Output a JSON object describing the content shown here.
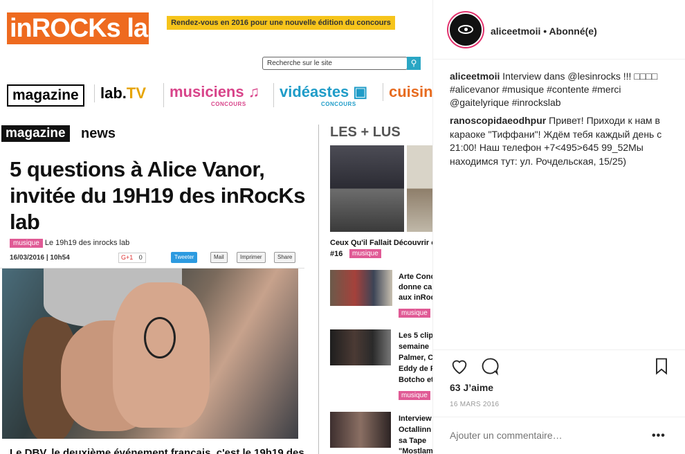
{
  "photo": {
    "logo": "inROCKs lab",
    "banner": "Rendez-vous en 2016 pour une nouvelle édition du concours",
    "search_placeholder": "Recherche sur le site",
    "nav": {
      "magazine": "magazine",
      "lab_prefix": "lab.",
      "lab_suffix": "TV",
      "musiciens": "musiciens",
      "musiciens_sub": "CONCOURS",
      "videastes": "vidéastes",
      "videastes_sub": "CONCOURS",
      "cuisine": "cuisin"
    },
    "section": "magazine",
    "section_sub": "news",
    "headline": "5 questions à Alice Vanor, invitée du 19H19 des inRocKs lab",
    "tag": "musique",
    "tagline": "Le 19h19 des inrocks lab",
    "date": "16/03/2016 | 10h54",
    "gplus": "G+1",
    "gplus_count": "0",
    "share_buttons": [
      "Tweeter",
      "Mail",
      "Imprimer",
      "Share"
    ],
    "bottom_text": "Le DBV, le deuxième événement francais, c'est le 19h19 des",
    "sidebar": {
      "title": "LES + LUS",
      "item1_caption": "Ceux Qu'il Fallait Découvrir c",
      "item1_num": "#16",
      "item1_tag": "musique",
      "item2_lines": [
        "Arte Conc",
        "donne ca",
        "aux inRoc"
      ],
      "item2_tag": "musique",
      "item3_lines": [
        "Les 5 clip",
        "semaine",
        "Palmer, C",
        "Eddy de F",
        "Botcho et"
      ],
      "item3_tag": "musique",
      "item4_lines": [
        "Interview",
        "Octallinn",
        "sa Tape",
        "\"Mostlam"
      ]
    }
  },
  "instagram": {
    "username": "aliceetmoii",
    "follow": "• Abonné(e)",
    "caption_user": "aliceetmoii",
    "caption_text": "Interview dans @lesinrocks !!! □□□□ #alicevanor #musique #contente #merci @gaitelyrique #inrockslab",
    "comment_user": "ranoscopidaeodhpur",
    "comment_text": "Привет! Приходи к нам в караоке \"Тиффани\"! Ждём тебя каждый день с 21:00! Наш телефон +7<495>645 99_52Мы находимся тут: ул. Рочдельская, 15/25)",
    "likes": "63 J’aime",
    "date": "16 MARS 2016",
    "add_comment_placeholder": "Ajouter un commentaire…",
    "more": "•••"
  },
  "colors": {
    "logo_orange": "#ee6a1f",
    "banner_yellow": "#f6c41b",
    "tag_pink": "#e05a95",
    "ig_text": "#262626",
    "ig_link": "#003569"
  }
}
